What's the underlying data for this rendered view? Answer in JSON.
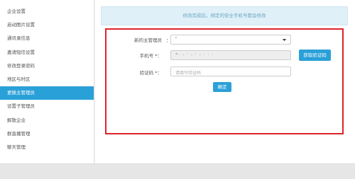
{
  "sidebar": {
    "items": [
      {
        "label": "企业设置"
      },
      {
        "label": "启动图片设置"
      },
      {
        "label": "通讯录信息"
      },
      {
        "label": "邀请短信设置"
      },
      {
        "label": "修改登录密码"
      },
      {
        "label": "地区与时区"
      },
      {
        "label": "更换主管理员",
        "active": true
      },
      {
        "label": "设置子管理员"
      },
      {
        "label": "解散企业"
      },
      {
        "label": "群直播管理"
      },
      {
        "label": "聊天管理"
      }
    ]
  },
  "notice": {
    "text": "修改完成后，绑定的安全手机号都会修改"
  },
  "form": {
    "admin_label": "新的主管理员",
    "admin_colon": "：",
    "admin_value": "'",
    "phone_label": "手机号 *：",
    "phone_value": "*· - · - · - · · ·",
    "get_code_label": "获取验证码",
    "code_label": "验证码 *：",
    "code_placeholder": "请填写验证码",
    "confirm_label": "确定"
  },
  "colors": {
    "accent": "#2aa0d8",
    "highlight_border": "#e0222b",
    "notice_bg": "#dff0f8"
  },
  "icons": {
    "dropdown": "caret-down-icon"
  }
}
